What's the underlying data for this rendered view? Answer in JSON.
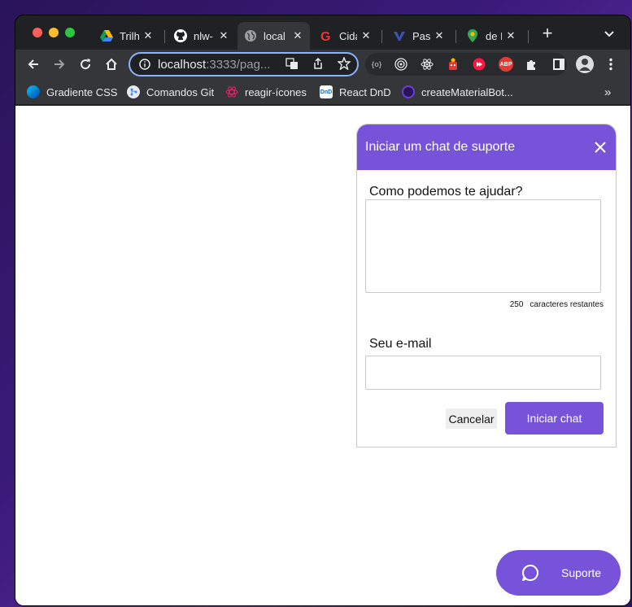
{
  "tabs": [
    {
      "title": "Trilha",
      "icon": "google-drive-icon"
    },
    {
      "title": "nlw-",
      "icon": "github-icon"
    },
    {
      "title": "local",
      "icon": "globe-icon",
      "active": true
    },
    {
      "title": "Cida",
      "icon": "g-logo-icon"
    },
    {
      "title": "Pass",
      "icon": "vs-icon"
    },
    {
      "title": "de R",
      "icon": "maps-pin-icon"
    }
  ],
  "new_tab_label": "+",
  "omnibox": {
    "host": "localhost",
    "path": ":3333/pag..."
  },
  "bookmarks": [
    {
      "label": "Gradiente CSS",
      "icon": "gradient-icon"
    },
    {
      "label": "Comandos Git",
      "icon": "git-icon"
    },
    {
      "label": "reagir-ícones",
      "icon": "react-icon"
    },
    {
      "label": "React DnD",
      "icon": "dnd-icon",
      "icon_text": "DnD"
    },
    {
      "label": "createMaterialBot...",
      "icon": "material-icon"
    }
  ],
  "bookmarks_overflow": "»",
  "extensions": {
    "abp_text": "ABP",
    "code_text": "{o}"
  },
  "widget": {
    "title": "Iniciar um chat de suporte",
    "question_label": "Como podemos te ajudar?",
    "message_value": "",
    "counter_number": "250",
    "counter_text": "caracteres restantes",
    "email_label": "Seu e-mail",
    "email_value": "",
    "cancel_label": "Cancelar",
    "submit_label": "Iniciar chat"
  },
  "support_button": {
    "label": "Suporte"
  },
  "colors": {
    "brand": "#7653d8",
    "page_bg": "#ffffff",
    "chrome_dark": "#202124"
  }
}
